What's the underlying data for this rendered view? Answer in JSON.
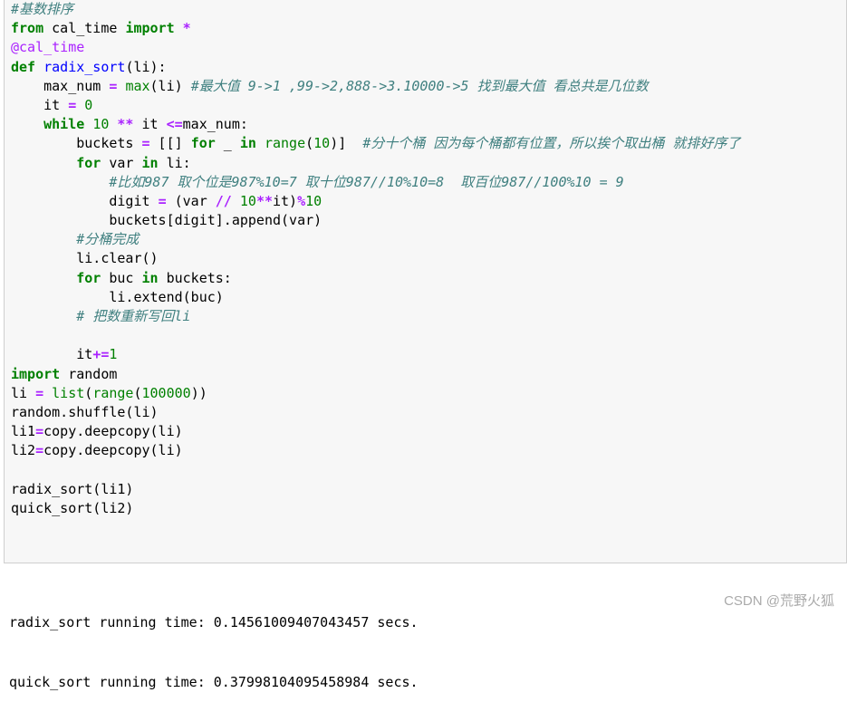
{
  "code_lines": [
    [
      {
        "t": "#基数排序",
        "c": "cm"
      }
    ],
    [
      {
        "t": "from",
        "c": "kw"
      },
      {
        "t": " cal_time ",
        "c": ""
      },
      {
        "t": "import",
        "c": "kw"
      },
      {
        "t": " ",
        "c": ""
      },
      {
        "t": "*",
        "c": "op"
      }
    ],
    [
      {
        "t": "@cal_time",
        "c": "deco"
      }
    ],
    [
      {
        "t": "def",
        "c": "kw"
      },
      {
        "t": " ",
        "c": ""
      },
      {
        "t": "radix_sort",
        "c": "fn"
      },
      {
        "t": "(li):",
        "c": ""
      }
    ],
    [
      {
        "t": "    max_num ",
        "c": ""
      },
      {
        "t": "=",
        "c": "op"
      },
      {
        "t": " ",
        "c": ""
      },
      {
        "t": "max",
        "c": "bi"
      },
      {
        "t": "(li) ",
        "c": ""
      },
      {
        "t": "#最大值 9->1 ,99->2,888->3.10000->5 找到最大值 看总共是几位数",
        "c": "cm"
      }
    ],
    [
      {
        "t": "    it ",
        "c": ""
      },
      {
        "t": "=",
        "c": "op"
      },
      {
        "t": " ",
        "c": ""
      },
      {
        "t": "0",
        "c": "num"
      }
    ],
    [
      {
        "t": "    ",
        "c": ""
      },
      {
        "t": "while",
        "c": "kw"
      },
      {
        "t": " ",
        "c": ""
      },
      {
        "t": "10",
        "c": "num"
      },
      {
        "t": " ",
        "c": ""
      },
      {
        "t": "**",
        "c": "op"
      },
      {
        "t": " it ",
        "c": ""
      },
      {
        "t": "<=",
        "c": "op"
      },
      {
        "t": "max_num:",
        "c": ""
      }
    ],
    [
      {
        "t": "        buckets ",
        "c": ""
      },
      {
        "t": "=",
        "c": "op"
      },
      {
        "t": " [[] ",
        "c": ""
      },
      {
        "t": "for",
        "c": "kw"
      },
      {
        "t": " _ ",
        "c": ""
      },
      {
        "t": "in",
        "c": "kw"
      },
      {
        "t": " ",
        "c": ""
      },
      {
        "t": "range",
        "c": "bi"
      },
      {
        "t": "(",
        "c": ""
      },
      {
        "t": "10",
        "c": "num"
      },
      {
        "t": ")]  ",
        "c": ""
      },
      {
        "t": "#分十个桶 因为每个桶都有位置，所以挨个取出桶 就排好序了",
        "c": "cm"
      }
    ],
    [
      {
        "t": "        ",
        "c": ""
      },
      {
        "t": "for",
        "c": "kw"
      },
      {
        "t": " var ",
        "c": ""
      },
      {
        "t": "in",
        "c": "kw"
      },
      {
        "t": " li:",
        "c": ""
      }
    ],
    [
      {
        "t": "            ",
        "c": ""
      },
      {
        "t": "#比如987 取个位是987%10=7 取十位987//10%10=8  取百位987//100%10 = 9",
        "c": "cm"
      }
    ],
    [
      {
        "t": "            digit ",
        "c": ""
      },
      {
        "t": "=",
        "c": "op"
      },
      {
        "t": " (var ",
        "c": ""
      },
      {
        "t": "//",
        "c": "op"
      },
      {
        "t": " ",
        "c": ""
      },
      {
        "t": "10",
        "c": "num"
      },
      {
        "t": "**",
        "c": "op"
      },
      {
        "t": "it)",
        "c": ""
      },
      {
        "t": "%",
        "c": "op"
      },
      {
        "t": "10",
        "c": "num"
      }
    ],
    [
      {
        "t": "            buckets[digit].append(var)",
        "c": ""
      }
    ],
    [
      {
        "t": "        ",
        "c": ""
      },
      {
        "t": "#分桶完成",
        "c": "cm"
      }
    ],
    [
      {
        "t": "        li.clear()",
        "c": ""
      }
    ],
    [
      {
        "t": "        ",
        "c": ""
      },
      {
        "t": "for",
        "c": "kw"
      },
      {
        "t": " buc ",
        "c": ""
      },
      {
        "t": "in",
        "c": "kw"
      },
      {
        "t": " buckets:",
        "c": ""
      }
    ],
    [
      {
        "t": "            li.extend(buc)",
        "c": ""
      }
    ],
    [
      {
        "t": "        ",
        "c": ""
      },
      {
        "t": "# 把数重新写回li",
        "c": "cm"
      }
    ],
    [
      {
        "t": "",
        "c": ""
      }
    ],
    [
      {
        "t": "        it",
        "c": ""
      },
      {
        "t": "+=",
        "c": "op"
      },
      {
        "t": "1",
        "c": "num"
      }
    ],
    [
      {
        "t": "import",
        "c": "kw"
      },
      {
        "t": " random",
        "c": ""
      }
    ],
    [
      {
        "t": "li ",
        "c": ""
      },
      {
        "t": "=",
        "c": "op"
      },
      {
        "t": " ",
        "c": ""
      },
      {
        "t": "list",
        "c": "bi"
      },
      {
        "t": "(",
        "c": ""
      },
      {
        "t": "range",
        "c": "bi"
      },
      {
        "t": "(",
        "c": ""
      },
      {
        "t": "100000",
        "c": "num"
      },
      {
        "t": "))",
        "c": ""
      }
    ],
    [
      {
        "t": "random.shuffle(li)",
        "c": ""
      }
    ],
    [
      {
        "t": "li1",
        "c": ""
      },
      {
        "t": "=",
        "c": "op"
      },
      {
        "t": "copy.deepcopy(li)",
        "c": ""
      }
    ],
    [
      {
        "t": "li2",
        "c": ""
      },
      {
        "t": "=",
        "c": "op"
      },
      {
        "t": "copy.deepcopy(li)",
        "c": ""
      }
    ],
    [
      {
        "t": "",
        "c": ""
      }
    ],
    [
      {
        "t": "radix_sort(li1)",
        "c": ""
      }
    ],
    [
      {
        "t": "quick_sort(li2)",
        "c": ""
      }
    ]
  ],
  "output": {
    "line1": "radix_sort running time: 0.14561009407043457 secs.",
    "line2": "quick_sort running time: 0.37998104095458984 secs."
  },
  "watermark": "CSDN @荒野火狐"
}
